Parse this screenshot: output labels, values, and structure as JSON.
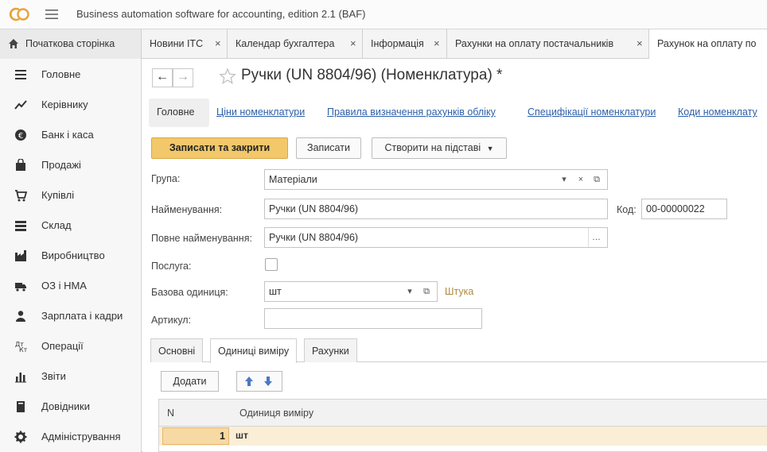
{
  "app": {
    "title": "Business automation software for accounting, edition 2.1  (BAF)"
  },
  "tabs": {
    "home": "Початкова сторінка",
    "items": [
      {
        "label": "Новини ITC"
      },
      {
        "label": "Календар бухгалтера"
      },
      {
        "label": "Інформація"
      },
      {
        "label": "Рахунки на оплату постачальників"
      },
      {
        "label": "Рахунок на оплату по"
      }
    ],
    "close_glyph": "×"
  },
  "sidebar": {
    "items": [
      {
        "label": "Головне",
        "icon": "menu-lines-icon"
      },
      {
        "label": "Керівнику",
        "icon": "trend-chart-icon"
      },
      {
        "label": "Банк і каса",
        "icon": "coin-icon"
      },
      {
        "label": "Продажі",
        "icon": "shopping-bag-icon"
      },
      {
        "label": "Купівлі",
        "icon": "cart-icon"
      },
      {
        "label": "Склад",
        "icon": "warehouse-icon"
      },
      {
        "label": "Виробництво",
        "icon": "factory-icon"
      },
      {
        "label": "ОЗ і НМА",
        "icon": "truck-icon"
      },
      {
        "label": "Зарплата і кадри",
        "icon": "person-icon"
      },
      {
        "label": "Операції",
        "icon": "operations-icon"
      },
      {
        "label": "Звіти",
        "icon": "bar-chart-icon"
      },
      {
        "label": "Довідники",
        "icon": "book-icon"
      },
      {
        "label": "Адміністрування",
        "icon": "gear-icon"
      }
    ]
  },
  "form": {
    "title": "Ручки (UN 8804/96) (Номенклатура) *",
    "sections": [
      {
        "label": "Головне",
        "active": true
      },
      {
        "label": "Ціни номенклатури"
      },
      {
        "label": "Правила визначення рахунків обліку"
      },
      {
        "label": "Специфікації номенклатури"
      },
      {
        "label": "Коди номенклату"
      }
    ],
    "buttons": {
      "save_close": "Записати та закрити",
      "save": "Записати",
      "create_based": "Створити на підставі"
    },
    "fields": {
      "group_label": "Група:",
      "group_value": "Матеріали",
      "name_label": "Найменування:",
      "name_value": "Ручки (UN 8804/96)",
      "code_label": "Код:",
      "code_value": "00-00000022",
      "full_name_label": "Повне найменування:",
      "full_name_value": "Ручки (UN 8804/96)",
      "service_label": "Послуга:",
      "base_unit_label": "Базова одиниця:",
      "base_unit_value": "шт",
      "base_unit_name": "Штука",
      "article_label": "Артикул:",
      "article_value": ""
    },
    "lower_tabs": [
      {
        "label": "Основні"
      },
      {
        "label": "Одиниці виміру",
        "active": true
      },
      {
        "label": "Рахунки"
      }
    ],
    "add_button": "Додати",
    "grid": {
      "headers": {
        "n": "N",
        "unit": "Одиниця виміру"
      },
      "rows": [
        {
          "n": "1",
          "unit": "шт"
        }
      ]
    }
  },
  "colors": {
    "primary_button": "#f2c86a",
    "link": "#2d5fa8",
    "selected_row": "#fbeed7"
  }
}
